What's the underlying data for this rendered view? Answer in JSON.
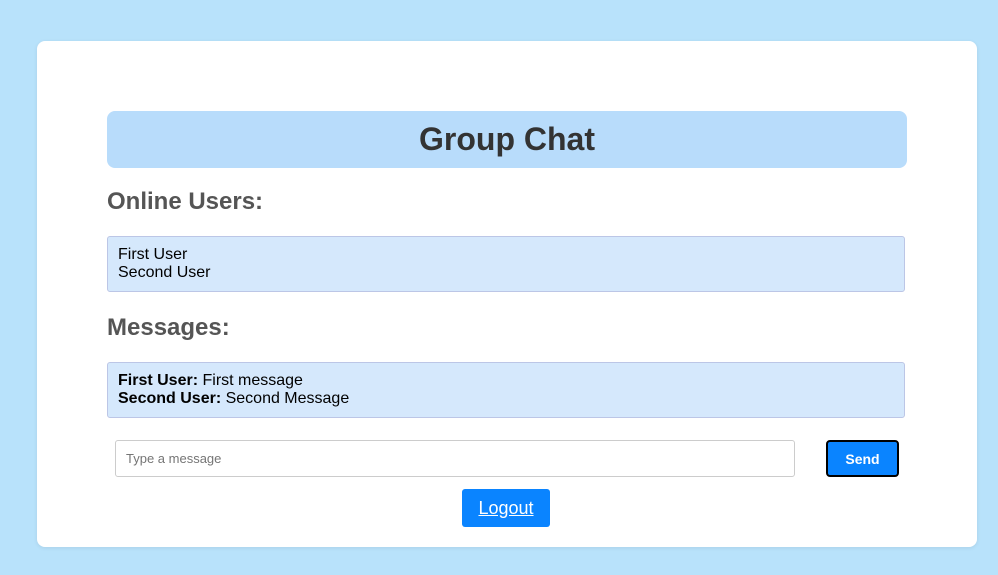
{
  "header": {
    "title": "Group Chat"
  },
  "online_users": {
    "title": "Online Users:",
    "users": [
      "First User",
      "Second User"
    ]
  },
  "messages": {
    "title": "Messages:",
    "items": [
      {
        "user": "First User:",
        "text": "First message"
      },
      {
        "user": "Second User:",
        "text": "Second Message"
      }
    ]
  },
  "composer": {
    "placeholder": "Type a message",
    "value": "",
    "send_label": "Send"
  },
  "logout_label": "Logout",
  "colors": {
    "page_background": "#b8e2fb",
    "header_background": "#b8dcfb",
    "box_background": "#d5e8fc",
    "accent": "#0a84ff"
  }
}
